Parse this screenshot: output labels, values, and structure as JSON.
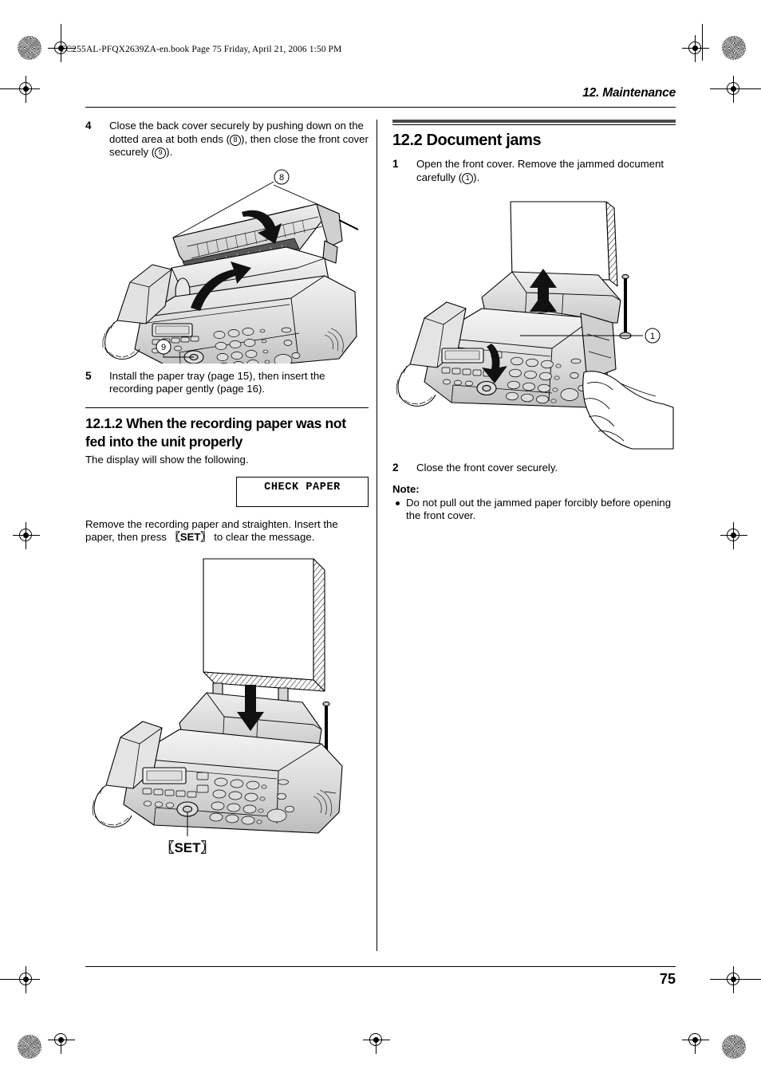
{
  "print_marks": {
    "file_stamp": "FC255AL-PFQX2639ZA-en.book  Page 75  Friday, April 21, 2006  1:50 PM"
  },
  "header": {
    "running_head": "12. Maintenance"
  },
  "footer": {
    "page_number": "75"
  },
  "left_column": {
    "step4": {
      "number": "4",
      "text_a": "Close the back cover securely by pushing down on the dotted area at both ends (",
      "callout_a": "8",
      "text_b": "), then close the front cover securely (",
      "callout_b": "9",
      "text_c": ")."
    },
    "figure_back_cover": {
      "caption_callout_top": "8",
      "caption_callout_bottom": "9",
      "alt": "Fax machine with back cover raised, arrows showing cover closing"
    },
    "step5": {
      "number": "5",
      "text": "Install the paper tray (page 15), then insert the recording paper gently (page 16)."
    },
    "subsection": {
      "heading": "12.1.2 When the recording paper was not fed into the unit properly",
      "intro": "The display will show the following.",
      "display_message": "CHECK  PAPER",
      "after_a": "Remove the recording paper and straighten. Insert the paper, then press ",
      "after_key": "SET",
      "after_b": " to clear the message."
    },
    "figure_paper_insert": {
      "key_label": "SET",
      "alt": "Fax machine with stack of recording paper being inserted into the paper tray"
    }
  },
  "right_column": {
    "section": {
      "heading": "12.2 Document jams"
    },
    "step1": {
      "number": "1",
      "text_a": "Open the front cover. Remove the jammed document carefully (",
      "callout_a": "1",
      "text_b": ")."
    },
    "figure_document_jam": {
      "callout": "1",
      "alt": "Hand opening the front cover of the fax machine to remove a jammed document"
    },
    "step2": {
      "number": "2",
      "text": "Close the front cover securely."
    },
    "note": {
      "title": "Note:",
      "items": [
        "Do not pull out the jammed paper forcibly before opening the front cover."
      ]
    }
  }
}
